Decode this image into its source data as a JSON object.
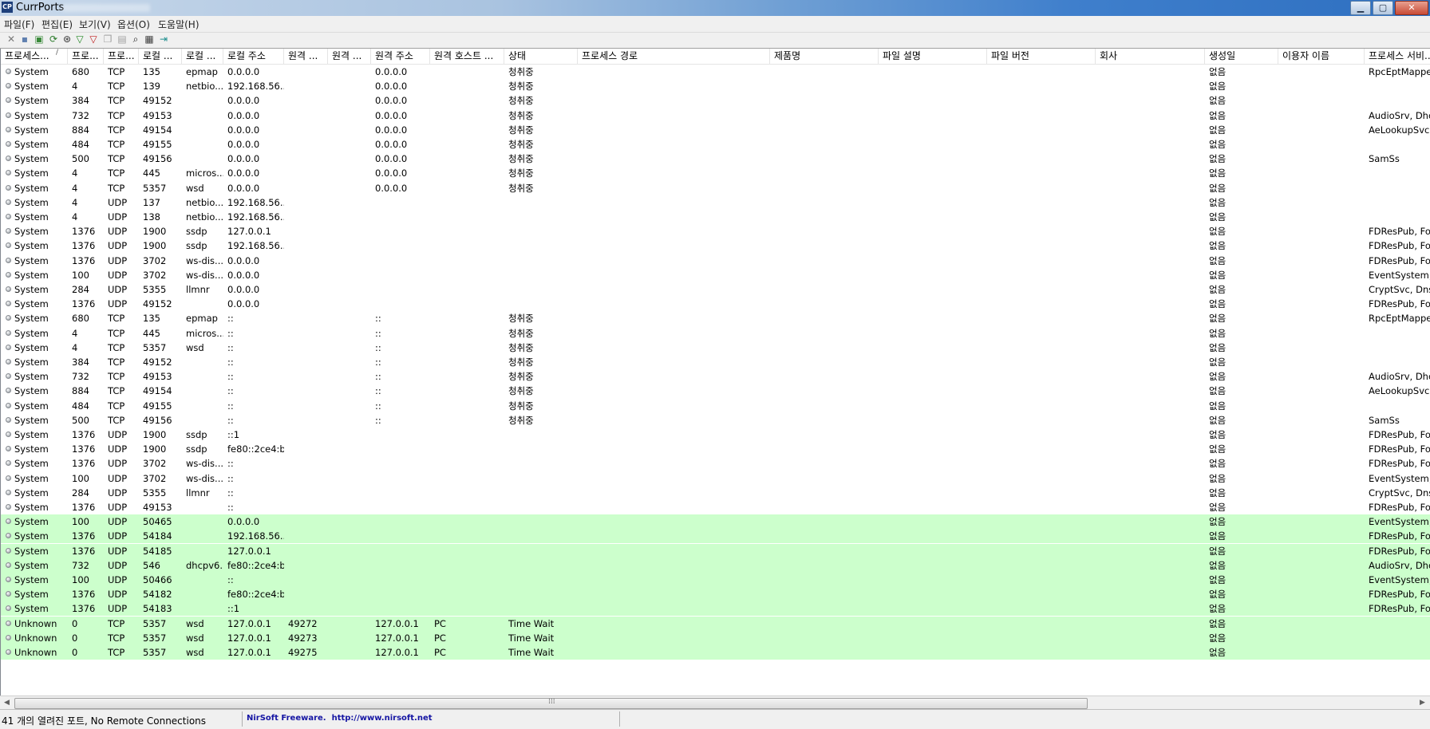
{
  "window": {
    "title": "CurrPorts",
    "title_extra": "",
    "icon_text": "CP"
  },
  "menu": [
    "파일(F)",
    "편집(E)",
    "보기(V)",
    "옵션(O)",
    "도움말(H)"
  ],
  "toolbar_icons": [
    {
      "name": "close-connection-icon",
      "glyph": "✕",
      "color": "#7a7a7a"
    },
    {
      "name": "save-icon",
      "glyph": "▪",
      "color": "#6080b0"
    },
    {
      "name": "html-report-icon",
      "glyph": "▣",
      "color": "#3a8a3a"
    },
    {
      "name": "refresh-icon",
      "glyph": "⟳",
      "color": "#2a7a2a"
    },
    {
      "name": "filter-icon",
      "glyph": "⊛",
      "color": "#333333"
    },
    {
      "name": "funnel-icon",
      "glyph": "▽",
      "color": "#228822"
    },
    {
      "name": "funnel-red-icon",
      "glyph": "▽",
      "color": "#c02020"
    },
    {
      "name": "copy-icon",
      "glyph": "❐",
      "color": "#a0a0a0"
    },
    {
      "name": "properties-icon",
      "glyph": "▤",
      "color": "#a0a0a0"
    },
    {
      "name": "find-icon",
      "glyph": "⌕",
      "color": "#222222"
    },
    {
      "name": "report-icon",
      "glyph": "▦",
      "color": "#404040"
    },
    {
      "name": "exit-icon",
      "glyph": "⇥",
      "color": "#1f8f8f"
    }
  ],
  "columns": [
    "프로세스...",
    "프로...",
    "프로...",
    "로컬 ...",
    "로컬 ...",
    "로컬 주소",
    "원격 ...",
    "원격 ...",
    "원격 주소",
    "원격 호스트 ...",
    "상태",
    "프로세스 경로",
    "제품명",
    "파일 설명",
    "파일 버전",
    "회사",
    "생성일",
    "이용자 이름",
    "프로세스 서비..."
  ],
  "rows": [
    {
      "n": "System",
      "pid": "680",
      "proto": "TCP",
      "lport": "135",
      "lpname": "epmap",
      "laddr": "0.0.0.0",
      "rport": "",
      "rpname": "",
      "raddr": "0.0.0.0",
      "rhost": "",
      "state": "청취중",
      "created": "없음",
      "svc": "RpcEptMapper",
      "isnew": false
    },
    {
      "n": "System",
      "pid": "4",
      "proto": "TCP",
      "lport": "139",
      "lpname": "netbio...",
      "laddr": "192.168.56....",
      "rport": "",
      "rpname": "",
      "raddr": "0.0.0.0",
      "rhost": "",
      "state": "청취중",
      "created": "없음",
      "svc": "",
      "isnew": false
    },
    {
      "n": "System",
      "pid": "384",
      "proto": "TCP",
      "lport": "49152",
      "lpname": "",
      "laddr": "0.0.0.0",
      "rport": "",
      "rpname": "",
      "raddr": "0.0.0.0",
      "rhost": "",
      "state": "청취중",
      "created": "없음",
      "svc": "",
      "isnew": false
    },
    {
      "n": "System",
      "pid": "732",
      "proto": "TCP",
      "lport": "49153",
      "lpname": "",
      "laddr": "0.0.0.0",
      "rport": "",
      "rpname": "",
      "raddr": "0.0.0.0",
      "rhost": "",
      "state": "청취중",
      "created": "없음",
      "svc": "AudioSrv, Dhcp",
      "isnew": false
    },
    {
      "n": "System",
      "pid": "884",
      "proto": "TCP",
      "lport": "49154",
      "lpname": "",
      "laddr": "0.0.0.0",
      "rport": "",
      "rpname": "",
      "raddr": "0.0.0.0",
      "rhost": "",
      "state": "청취중",
      "created": "없음",
      "svc": "AeLookupSvc,",
      "isnew": false
    },
    {
      "n": "System",
      "pid": "484",
      "proto": "TCP",
      "lport": "49155",
      "lpname": "",
      "laddr": "0.0.0.0",
      "rport": "",
      "rpname": "",
      "raddr": "0.0.0.0",
      "rhost": "",
      "state": "청취중",
      "created": "없음",
      "svc": "",
      "isnew": false
    },
    {
      "n": "System",
      "pid": "500",
      "proto": "TCP",
      "lport": "49156",
      "lpname": "",
      "laddr": "0.0.0.0",
      "rport": "",
      "rpname": "",
      "raddr": "0.0.0.0",
      "rhost": "",
      "state": "청취중",
      "created": "없음",
      "svc": "SamSs",
      "isnew": false
    },
    {
      "n": "System",
      "pid": "4",
      "proto": "TCP",
      "lport": "445",
      "lpname": "micros...",
      "laddr": "0.0.0.0",
      "rport": "",
      "rpname": "",
      "raddr": "0.0.0.0",
      "rhost": "",
      "state": "청취중",
      "created": "없음",
      "svc": "",
      "isnew": false
    },
    {
      "n": "System",
      "pid": "4",
      "proto": "TCP",
      "lport": "5357",
      "lpname": "wsd",
      "laddr": "0.0.0.0",
      "rport": "",
      "rpname": "",
      "raddr": "0.0.0.0",
      "rhost": "",
      "state": "청취중",
      "created": "없음",
      "svc": "",
      "isnew": false
    },
    {
      "n": "System",
      "pid": "4",
      "proto": "UDP",
      "lport": "137",
      "lpname": "netbio...",
      "laddr": "192.168.56....",
      "rport": "",
      "rpname": "",
      "raddr": "",
      "rhost": "",
      "state": "",
      "created": "없음",
      "svc": "",
      "isnew": false
    },
    {
      "n": "System",
      "pid": "4",
      "proto": "UDP",
      "lport": "138",
      "lpname": "netbio...",
      "laddr": "192.168.56....",
      "rport": "",
      "rpname": "",
      "raddr": "",
      "rhost": "",
      "state": "",
      "created": "없음",
      "svc": "",
      "isnew": false
    },
    {
      "n": "System",
      "pid": "1376",
      "proto": "UDP",
      "lport": "1900",
      "lpname": "ssdp",
      "laddr": "127.0.0.1",
      "rport": "",
      "rpname": "",
      "raddr": "",
      "rhost": "",
      "state": "",
      "created": "없음",
      "svc": "FDResPub, For",
      "isnew": false
    },
    {
      "n": "System",
      "pid": "1376",
      "proto": "UDP",
      "lport": "1900",
      "lpname": "ssdp",
      "laddr": "192.168.56....",
      "rport": "",
      "rpname": "",
      "raddr": "",
      "rhost": "",
      "state": "",
      "created": "없음",
      "svc": "FDResPub, For",
      "isnew": false
    },
    {
      "n": "System",
      "pid": "1376",
      "proto": "UDP",
      "lport": "3702",
      "lpname": "ws-dis...",
      "laddr": "0.0.0.0",
      "rport": "",
      "rpname": "",
      "raddr": "",
      "rhost": "",
      "state": "",
      "created": "없음",
      "svc": "FDResPub, For",
      "isnew": false
    },
    {
      "n": "System",
      "pid": "100",
      "proto": "UDP",
      "lport": "3702",
      "lpname": "ws-dis...",
      "laddr": "0.0.0.0",
      "rport": "",
      "rpname": "",
      "raddr": "",
      "rhost": "",
      "state": "",
      "created": "없음",
      "svc": "EventSystem, f",
      "isnew": false
    },
    {
      "n": "System",
      "pid": "284",
      "proto": "UDP",
      "lport": "5355",
      "lpname": "llmnr",
      "laddr": "0.0.0.0",
      "rport": "",
      "rpname": "",
      "raddr": "",
      "rhost": "",
      "state": "",
      "created": "없음",
      "svc": "CryptSvc, Dnsc",
      "isnew": false
    },
    {
      "n": "System",
      "pid": "1376",
      "proto": "UDP",
      "lport": "49152",
      "lpname": "",
      "laddr": "0.0.0.0",
      "rport": "",
      "rpname": "",
      "raddr": "",
      "rhost": "",
      "state": "",
      "created": "없음",
      "svc": "FDResPub, For",
      "isnew": false
    },
    {
      "n": "System",
      "pid": "680",
      "proto": "TCP",
      "lport": "135",
      "lpname": "epmap",
      "laddr": "::",
      "rport": "",
      "rpname": "",
      "raddr": "::",
      "rhost": "",
      "state": "청취중",
      "created": "없음",
      "svc": "RpcEptMapper",
      "isnew": false
    },
    {
      "n": "System",
      "pid": "4",
      "proto": "TCP",
      "lport": "445",
      "lpname": "micros...",
      "laddr": "::",
      "rport": "",
      "rpname": "",
      "raddr": "::",
      "rhost": "",
      "state": "청취중",
      "created": "없음",
      "svc": "",
      "isnew": false
    },
    {
      "n": "System",
      "pid": "4",
      "proto": "TCP",
      "lport": "5357",
      "lpname": "wsd",
      "laddr": "::",
      "rport": "",
      "rpname": "",
      "raddr": "::",
      "rhost": "",
      "state": "청취중",
      "created": "없음",
      "svc": "",
      "isnew": false
    },
    {
      "n": "System",
      "pid": "384",
      "proto": "TCP",
      "lport": "49152",
      "lpname": "",
      "laddr": "::",
      "rport": "",
      "rpname": "",
      "raddr": "::",
      "rhost": "",
      "state": "청취중",
      "created": "없음",
      "svc": "",
      "isnew": false
    },
    {
      "n": "System",
      "pid": "732",
      "proto": "TCP",
      "lport": "49153",
      "lpname": "",
      "laddr": "::",
      "rport": "",
      "rpname": "",
      "raddr": "::",
      "rhost": "",
      "state": "청취중",
      "created": "없음",
      "svc": "AudioSrv, Dhcp",
      "isnew": false
    },
    {
      "n": "System",
      "pid": "884",
      "proto": "TCP",
      "lport": "49154",
      "lpname": "",
      "laddr": "::",
      "rport": "",
      "rpname": "",
      "raddr": "::",
      "rhost": "",
      "state": "청취중",
      "created": "없음",
      "svc": "AeLookupSvc,",
      "isnew": false
    },
    {
      "n": "System",
      "pid": "484",
      "proto": "TCP",
      "lport": "49155",
      "lpname": "",
      "laddr": "::",
      "rport": "",
      "rpname": "",
      "raddr": "::",
      "rhost": "",
      "state": "청취중",
      "created": "없음",
      "svc": "",
      "isnew": false
    },
    {
      "n": "System",
      "pid": "500",
      "proto": "TCP",
      "lport": "49156",
      "lpname": "",
      "laddr": "::",
      "rport": "",
      "rpname": "",
      "raddr": "::",
      "rhost": "",
      "state": "청취중",
      "created": "없음",
      "svc": "SamSs",
      "isnew": false
    },
    {
      "n": "System",
      "pid": "1376",
      "proto": "UDP",
      "lport": "1900",
      "lpname": "ssdp",
      "laddr": "::1",
      "rport": "",
      "rpname": "",
      "raddr": "",
      "rhost": "",
      "state": "",
      "created": "없음",
      "svc": "FDResPub, For",
      "isnew": false
    },
    {
      "n": "System",
      "pid": "1376",
      "proto": "UDP",
      "lport": "1900",
      "lpname": "ssdp",
      "laddr": "fe80::2ce4:b...",
      "rport": "",
      "rpname": "",
      "raddr": "",
      "rhost": "",
      "state": "",
      "created": "없음",
      "svc": "FDResPub, For",
      "isnew": false
    },
    {
      "n": "System",
      "pid": "1376",
      "proto": "UDP",
      "lport": "3702",
      "lpname": "ws-dis...",
      "laddr": "::",
      "rport": "",
      "rpname": "",
      "raddr": "",
      "rhost": "",
      "state": "",
      "created": "없음",
      "svc": "FDResPub, For",
      "isnew": false
    },
    {
      "n": "System",
      "pid": "100",
      "proto": "UDP",
      "lport": "3702",
      "lpname": "ws-dis...",
      "laddr": "::",
      "rport": "",
      "rpname": "",
      "raddr": "",
      "rhost": "",
      "state": "",
      "created": "없음",
      "svc": "EventSystem, f",
      "isnew": false
    },
    {
      "n": "System",
      "pid": "284",
      "proto": "UDP",
      "lport": "5355",
      "lpname": "llmnr",
      "laddr": "::",
      "rport": "",
      "rpname": "",
      "raddr": "",
      "rhost": "",
      "state": "",
      "created": "없음",
      "svc": "CryptSvc, Dnsc",
      "isnew": false
    },
    {
      "n": "System",
      "pid": "1376",
      "proto": "UDP",
      "lport": "49153",
      "lpname": "",
      "laddr": "::",
      "rport": "",
      "rpname": "",
      "raddr": "",
      "rhost": "",
      "state": "",
      "created": "없음",
      "svc": "FDResPub, For",
      "isnew": false
    },
    {
      "n": "System",
      "pid": "100",
      "proto": "UDP",
      "lport": "50465",
      "lpname": "",
      "laddr": "0.0.0.0",
      "rport": "",
      "rpname": "",
      "raddr": "",
      "rhost": "",
      "state": "",
      "created": "없음",
      "svc": "EventSystem, f",
      "isnew": true
    },
    {
      "n": "System",
      "pid": "1376",
      "proto": "UDP",
      "lport": "54184",
      "lpname": "",
      "laddr": "192.168.56....",
      "rport": "",
      "rpname": "",
      "raddr": "",
      "rhost": "",
      "state": "",
      "created": "없음",
      "svc": "FDResPub, For",
      "isnew": true
    },
    {
      "n": "System",
      "pid": "1376",
      "proto": "UDP",
      "lport": "54185",
      "lpname": "",
      "laddr": "127.0.0.1",
      "rport": "",
      "rpname": "",
      "raddr": "",
      "rhost": "",
      "state": "",
      "created": "없음",
      "svc": "FDResPub, For",
      "isnew": true
    },
    {
      "n": "System",
      "pid": "732",
      "proto": "UDP",
      "lport": "546",
      "lpname": "dhcpv6...",
      "laddr": "fe80::2ce4:b...",
      "rport": "",
      "rpname": "",
      "raddr": "",
      "rhost": "",
      "state": "",
      "created": "없음",
      "svc": "AudioSrv, Dhcp",
      "isnew": true
    },
    {
      "n": "System",
      "pid": "100",
      "proto": "UDP",
      "lport": "50466",
      "lpname": "",
      "laddr": "::",
      "rport": "",
      "rpname": "",
      "raddr": "",
      "rhost": "",
      "state": "",
      "created": "없음",
      "svc": "EventSystem, f",
      "isnew": true
    },
    {
      "n": "System",
      "pid": "1376",
      "proto": "UDP",
      "lport": "54182",
      "lpname": "",
      "laddr": "fe80::2ce4:b...",
      "rport": "",
      "rpname": "",
      "raddr": "",
      "rhost": "",
      "state": "",
      "created": "없음",
      "svc": "FDResPub, For",
      "isnew": true
    },
    {
      "n": "System",
      "pid": "1376",
      "proto": "UDP",
      "lport": "54183",
      "lpname": "",
      "laddr": "::1",
      "rport": "",
      "rpname": "",
      "raddr": "",
      "rhost": "",
      "state": "",
      "created": "없음",
      "svc": "FDResPub, For",
      "isnew": true
    },
    {
      "n": "Unknown",
      "pid": "0",
      "proto": "TCP",
      "lport": "5357",
      "lpname": "wsd",
      "laddr": "127.0.0.1",
      "rport": "49272",
      "rpname": "",
      "raddr": "127.0.0.1",
      "rhost": "PC",
      "state": "Time Wait",
      "created": "없음",
      "svc": "",
      "isnew": true
    },
    {
      "n": "Unknown",
      "pid": "0",
      "proto": "TCP",
      "lport": "5357",
      "lpname": "wsd",
      "laddr": "127.0.0.1",
      "rport": "49273",
      "rpname": "",
      "raddr": "127.0.0.1",
      "rhost": "PC",
      "state": "Time Wait",
      "created": "없음",
      "svc": "",
      "isnew": true
    },
    {
      "n": "Unknown",
      "pid": "0",
      "proto": "TCP",
      "lport": "5357",
      "lpname": "wsd",
      "laddr": "127.0.0.1",
      "rport": "49275",
      "rpname": "",
      "raddr": "127.0.0.1",
      "rhost": "PC",
      "state": "Time Wait",
      "created": "없음",
      "svc": "",
      "isnew": true
    }
  ],
  "colors": {
    "new_row_bg": "#ccffcc",
    "credit_text": "#1515a3"
  },
  "status": {
    "summary": "41 개의 열려진 포트, No Remote Connections",
    "credit_prefix": "NirSoft Freeware.",
    "credit_url": "http://www.nirsoft.net"
  }
}
